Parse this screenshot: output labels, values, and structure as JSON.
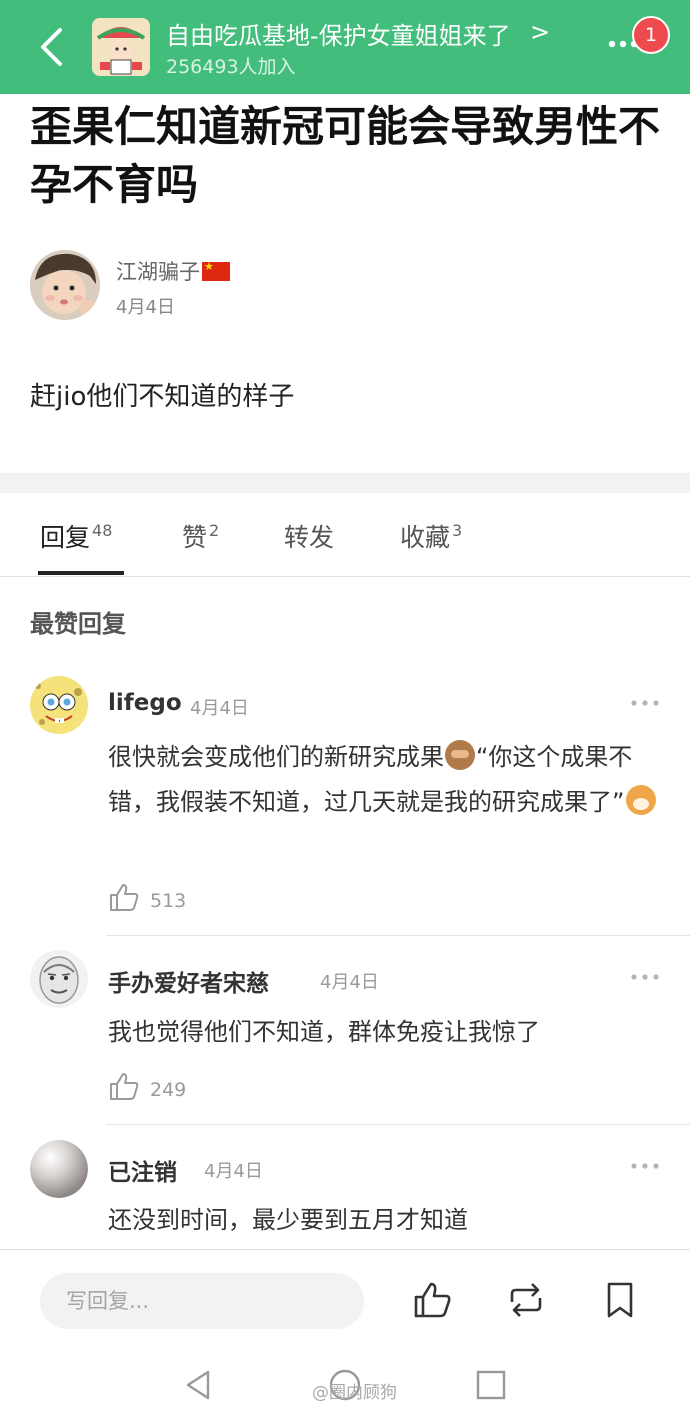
{
  "header": {
    "group_name": "自由吃瓜基地-保护女童姐姐来了",
    "chevron": ">",
    "members": "256493人加入",
    "notification_count": "1",
    "accent_color": "#43bd7c"
  },
  "post": {
    "title": "歪果仁知道新冠可能会导致男性不孕不育吗",
    "author": "江湖骗子",
    "date": "4月4日",
    "body": "赶jio他们不知道的样子"
  },
  "tabs": [
    {
      "label": "回复",
      "count": "48",
      "active": true
    },
    {
      "label": "赞",
      "count": "2",
      "active": false
    },
    {
      "label": "转发",
      "count": "",
      "active": false
    },
    {
      "label": "收藏",
      "count": "3",
      "active": false
    }
  ],
  "section_title": "最赞回复",
  "comments": [
    {
      "name": "lifego",
      "date": "4月4日",
      "text_part1": "很快就会变成他们的新研究成果",
      "text_part2": "“你这个成果不错，我假装不知道，过几天就是我的研究成果了”",
      "likes": "513"
    },
    {
      "name": "手办爱好者宋慈",
      "date": "4月4日",
      "text": "我也觉得他们不知道，群体免疫让我惊了",
      "likes": "249"
    },
    {
      "name": "已注销",
      "date": "4月4日",
      "text": "还没到时间，最少要到五月才知道"
    }
  ],
  "bottom_bar": {
    "reply_placeholder": "写回复..."
  },
  "watermark": "@圈内顾狗",
  "icons": [
    "back-arrow-icon",
    "more-dots-icon",
    "thumbs-up-icon",
    "repost-icon",
    "bookmark-icon",
    "nav-back-icon",
    "nav-home-icon",
    "nav-recents-icon"
  ]
}
